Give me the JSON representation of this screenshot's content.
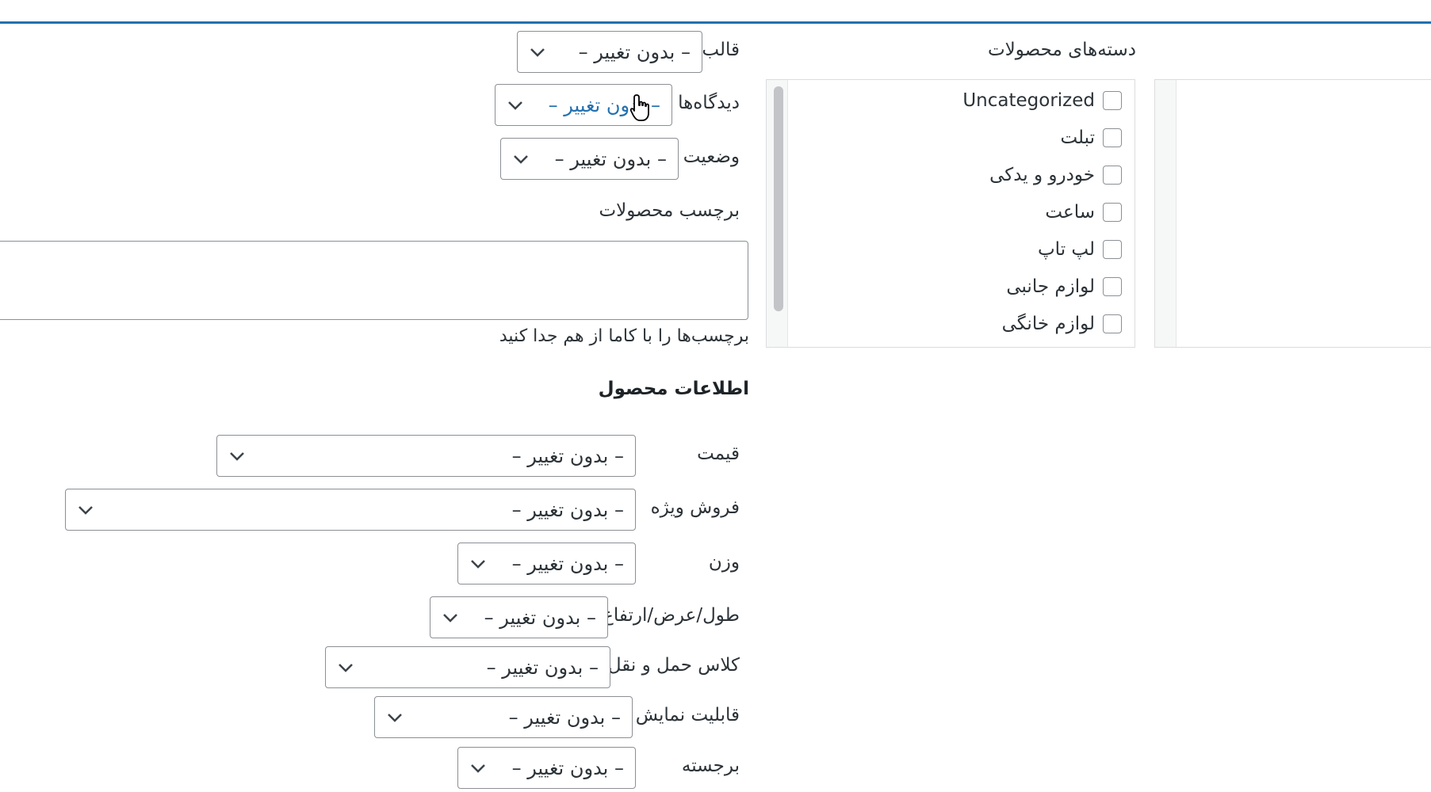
{
  "categories": {
    "heading": "دسته‌های محصولات",
    "items": [
      {
        "label": "Uncategorized"
      },
      {
        "label": "تبلت"
      },
      {
        "label": "خودرو و یدکی"
      },
      {
        "label": "ساعت"
      },
      {
        "label": "لپ تاپ"
      },
      {
        "label": "لوازم جانبی"
      },
      {
        "label": "لوازم خانگی"
      }
    ]
  },
  "fields": {
    "template": {
      "label": "قالب",
      "value": "– بدون تغییر –"
    },
    "comments": {
      "label": "دیدگاه‌ها",
      "value": "– بدون تغییر –"
    },
    "status": {
      "label": "وضعیت",
      "value": "– بدون تغییر –"
    }
  },
  "tags": {
    "label": "برچسب محصولات",
    "hint": "برچسب‌ها را با کاما از هم جدا کنید"
  },
  "product_info": {
    "title": "اطلاعات محصول",
    "price": {
      "label": "قیمت",
      "value": "– بدون تغییر –"
    },
    "sale": {
      "label": "فروش ویژه",
      "value": "– بدون تغییر –"
    },
    "weight": {
      "label": "وزن",
      "value": "– بدون تغییر –"
    },
    "dimensions": {
      "label": "طول/عرض/ارتفاع",
      "value": "– بدون تغییر –"
    },
    "shipping_class": {
      "label": "کلاس حمل و نقل",
      "value": "– بدون تغییر –"
    },
    "visibility": {
      "label": "قابلیت نمایش",
      "value": "– بدون تغییر –"
    },
    "featured": {
      "label": "برجسته",
      "value": "– بدون تغییر –"
    }
  },
  "colors": {
    "accent": "#2271b1",
    "border": "#8c8f94",
    "text": "#2c3338"
  },
  "icons": {
    "chevron": "chevron-down-icon",
    "cursor": "hand-pointer-icon"
  }
}
